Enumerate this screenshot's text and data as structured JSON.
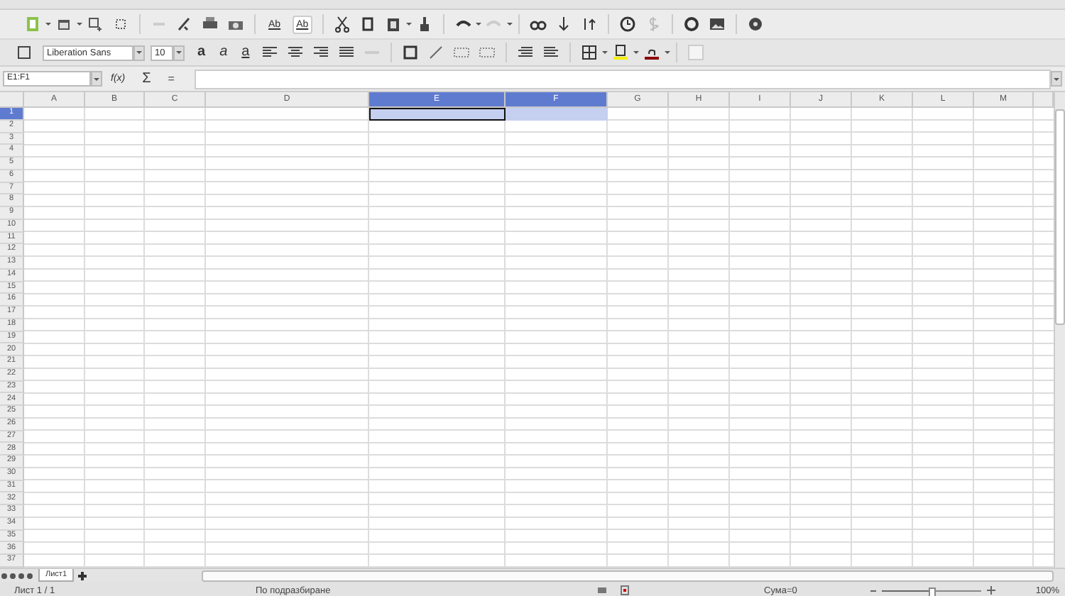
{
  "toolbar": {
    "spelling_labels": [
      "Ab",
      "Ab"
    ]
  },
  "format_bar": {
    "font_name": "Liberation Sans",
    "font_size": "10",
    "text_styles": [
      {
        "kind": "bold",
        "label": "a"
      },
      {
        "kind": "italic",
        "label": "a"
      },
      {
        "kind": "underline",
        "label": "a"
      }
    ]
  },
  "formula_bar": {
    "name_box": "E1:F1",
    "function_wizard": "f(x)",
    "sum": "Σ",
    "equals": "="
  },
  "sheet": {
    "columns": [
      {
        "label": "A",
        "selected": false
      },
      {
        "label": "B",
        "selected": false
      },
      {
        "label": "C",
        "selected": false
      },
      {
        "label": "D",
        "selected": false
      },
      {
        "label": "E",
        "selected": true
      },
      {
        "label": "F",
        "selected": true
      },
      {
        "label": "G",
        "selected": false
      },
      {
        "label": "H",
        "selected": false
      },
      {
        "label": "I",
        "selected": false
      },
      {
        "label": "J",
        "selected": false
      },
      {
        "label": "K",
        "selected": false
      },
      {
        "label": "L",
        "selected": false
      },
      {
        "label": "M",
        "selected": false
      }
    ],
    "rows": [
      {
        "label": "1",
        "selected": true
      },
      {
        "label": "2",
        "selected": false
      },
      {
        "label": "3",
        "selected": false
      },
      {
        "label": "4",
        "selected": false
      },
      {
        "label": "5",
        "selected": false
      },
      {
        "label": "6",
        "selected": false
      },
      {
        "label": "7",
        "selected": false
      },
      {
        "label": "8",
        "selected": false
      },
      {
        "label": "9",
        "selected": false
      },
      {
        "label": "10",
        "selected": false
      },
      {
        "label": "11",
        "selected": false
      },
      {
        "label": "12",
        "selected": false
      },
      {
        "label": "13",
        "selected": false
      },
      {
        "label": "14",
        "selected": false
      },
      {
        "label": "15",
        "selected": false
      },
      {
        "label": "16",
        "selected": false
      },
      {
        "label": "17",
        "selected": false
      },
      {
        "label": "18",
        "selected": false
      },
      {
        "label": "19",
        "selected": false
      },
      {
        "label": "20",
        "selected": false
      },
      {
        "label": "21",
        "selected": false
      },
      {
        "label": "22",
        "selected": false
      },
      {
        "label": "23",
        "selected": false
      },
      {
        "label": "24",
        "selected": false
      },
      {
        "label": "25",
        "selected": false
      },
      {
        "label": "26",
        "selected": false
      },
      {
        "label": "27",
        "selected": false
      },
      {
        "label": "28",
        "selected": false
      },
      {
        "label": "29",
        "selected": false
      },
      {
        "label": "30",
        "selected": false
      },
      {
        "label": "31",
        "selected": false
      },
      {
        "label": "32",
        "selected": false
      },
      {
        "label": "33",
        "selected": false
      },
      {
        "label": "34",
        "selected": false
      },
      {
        "label": "35",
        "selected": false
      },
      {
        "label": "36",
        "selected": false
      },
      {
        "label": "37",
        "selected": false
      }
    ]
  },
  "sheet_tabs": [
    {
      "label": "Лист1",
      "selected": true
    }
  ],
  "status_bar": {
    "sheet": "Лист 1 / 1",
    "page_style": "По подразбиране",
    "sum": "Сума=0",
    "zoom": {
      "level": 0.5
    },
    "zoom_percent": "100%"
  }
}
